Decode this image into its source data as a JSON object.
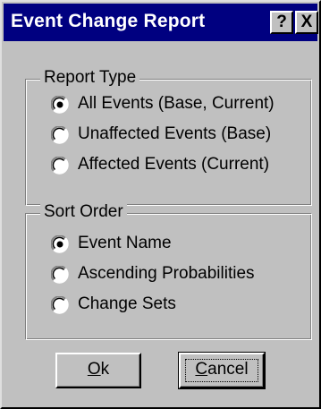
{
  "window": {
    "title": "Event Change Report",
    "help_label": "?",
    "close_label": "X"
  },
  "report_type": {
    "legend": "Report Type",
    "options": [
      {
        "label": "All Events (Base, Current)",
        "selected": true
      },
      {
        "label": "Unaffected Events (Base)",
        "selected": false
      },
      {
        "label": "Affected Events (Current)",
        "selected": false
      }
    ]
  },
  "sort_order": {
    "legend": "Sort Order",
    "options": [
      {
        "label": "Event Name",
        "selected": true
      },
      {
        "label": "Ascending Probabilities",
        "selected": false
      },
      {
        "label": "Change Sets",
        "selected": false
      }
    ]
  },
  "buttons": {
    "ok_access": "O",
    "ok_rest": "k",
    "cancel_access": "C",
    "cancel_rest": "ancel"
  }
}
